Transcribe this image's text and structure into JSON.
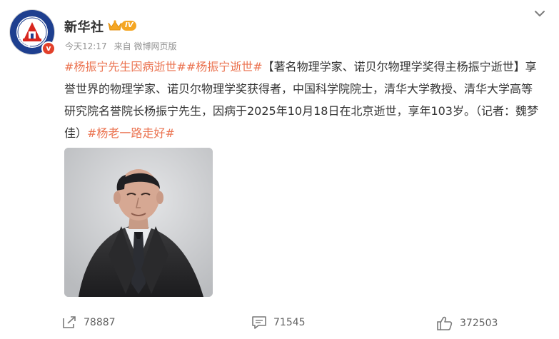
{
  "account": {
    "name": "新华社",
    "level_badge": "IV",
    "avatar_text": "XINHUA",
    "verified_mark": "v"
  },
  "post": {
    "time": "今天12:17",
    "source_prefix": "来自",
    "source": "微博网页版",
    "tag1": "#杨振宁先生因病逝世#",
    "tag2": "#杨振宁逝世#",
    "text_main": "【著名物理学家、诺贝尔物理学奖得主杨振宁逝世】享誉世界的物理学家、诺贝尔物理学奖获得者，中国科学院院士，清华大学教授、清华大学高等研究院名誉院长杨振宁先生，因病于2025年10月18日在北京逝世，享年103岁。（记者：魏梦佳）",
    "tag3": "#杨老一路走好#"
  },
  "actions": {
    "repost_count": "78887",
    "comment_count": "71545",
    "like_count": "372503"
  },
  "colors": {
    "tag": "#eb7350",
    "text": "#333333",
    "meta": "#939393",
    "brand_blue": "#1e3f8f",
    "verified_red": "#e2402a",
    "level_orange": "#f5a623"
  },
  "icons": {
    "more": "chevron-down-icon",
    "repost": "share-arrow-icon",
    "comment": "comment-icon",
    "like": "thumbs-up-icon",
    "vip": "crown-icon"
  }
}
